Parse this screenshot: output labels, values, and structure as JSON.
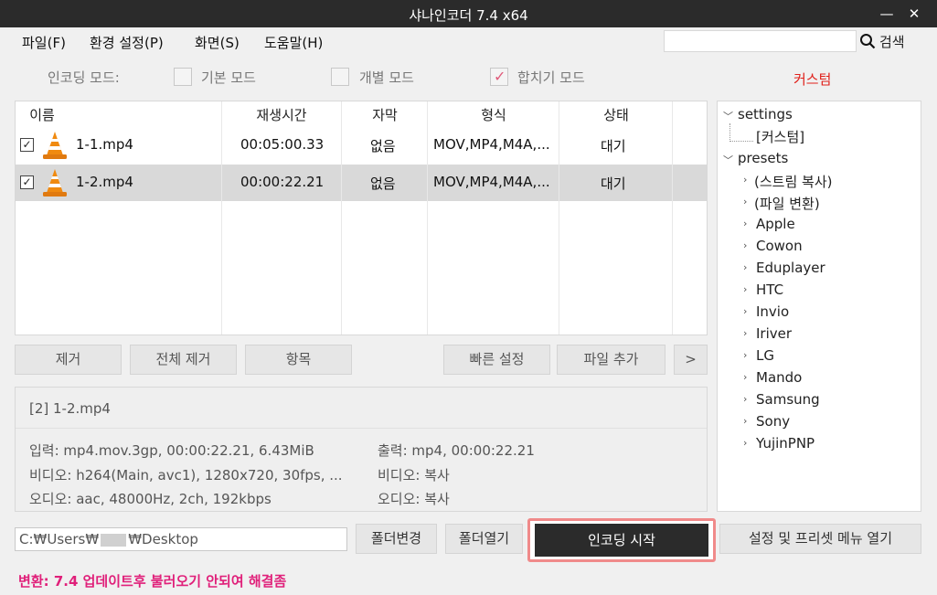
{
  "window": {
    "title": "샤나인코더  7.4 x64",
    "minimize": "—",
    "maximize": "□",
    "close": "✕"
  },
  "menu": {
    "file": "파일(F)",
    "settings": "환경 설정(P)",
    "view": "화면(S)",
    "help": "도움말(H)",
    "search_label": "검색",
    "search_value": ""
  },
  "mode": {
    "label": "인코딩 모드:",
    "basic": "기본 모드",
    "individual": "개별 모드",
    "merge": "합치기 모드",
    "merge_checked": true,
    "custom": "커스텀"
  },
  "table": {
    "columns": [
      "이름",
      "재생시간",
      "자막",
      "형식",
      "상태"
    ],
    "rows": [
      {
        "name": "1-1.mp4",
        "duration": "00:05:00.33",
        "subtitle": "없음",
        "format": "MOV,MP4,M4A,...",
        "status": "대기",
        "checked": true,
        "selected": false
      },
      {
        "name": "1-2.mp4",
        "duration": "00:00:22.21",
        "subtitle": "없음",
        "format": "MOV,MP4,M4A,...",
        "status": "대기",
        "checked": true,
        "selected": true
      }
    ]
  },
  "buttons": {
    "remove": "제거",
    "remove_all": "전체 제거",
    "items": "항목",
    "quick_settings": "빠른 설정",
    "add_file": "파일 추가",
    "more": ">"
  },
  "info": {
    "filename": "[2] 1-2.mp4",
    "input": "입력: mp4.mov.3gp, 00:00:22.21, 6.43MiB",
    "input_video": "비디오: h264(Main, avc1), 1280x720, 30fps, ...",
    "input_audio": "오디오: aac, 48000Hz, 2ch, 192kbps",
    "output": "출력: mp4, 00:00:22.21",
    "output_video": "비디오: 복사",
    "output_audio": "오디오: 복사"
  },
  "tree": {
    "settings": "settings",
    "settings_child": "[커스텀]",
    "presets": "presets",
    "preset_items": [
      "(스트림 복사)",
      "(파일 변환)",
      "Apple",
      "Cowon",
      "Eduplayer",
      "HTC",
      "Invio",
      "Iriver",
      "LG",
      "Mando",
      "Samsung",
      "Sony",
      "YujinPNP"
    ]
  },
  "bottom": {
    "path_prefix": "C:₩Users₩",
    "path_suffix": "₩Desktop",
    "change_folder": "폴더변경",
    "open_folder": "폴더열기",
    "start_encoding": "인코딩 시작",
    "open_menu": "설정 및 프리셋 메뉴 열기"
  },
  "status": {
    "text": "변환: 7.4 업데이트후 불러오기 안되여 해결좀"
  },
  "colors": {
    "titlebar": "#2b2b2b",
    "accent_red": "#e0201a",
    "status_pink": "#e0207a",
    "start_border": "#f08a8a",
    "selected_row": "#d9d9d9"
  }
}
